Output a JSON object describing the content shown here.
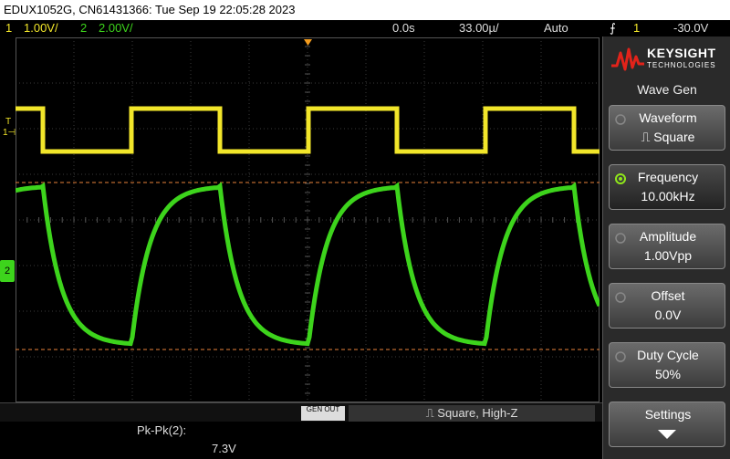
{
  "title_bar": {
    "text": "EDUX1052G, CN61431366: Tue Sep 19 22:05:28 2023"
  },
  "status": {
    "ch1_num": "1",
    "ch1_scale": "1.00V/",
    "ch2_num": "2",
    "ch2_scale": "2.00V/",
    "time_delay": "0.0s",
    "time_scale": "33.00µ/",
    "trigger_mode": "Auto",
    "trigger_icon": "rising-edge-icon",
    "trigger_source": "1",
    "trigger_level": "-30.0V"
  },
  "markers": {
    "ch1": "T\n1",
    "ch2": "2"
  },
  "softkeys": {
    "gen_out": "GEN OUT",
    "description": "⎍ Square, High-Z"
  },
  "measurement": {
    "label": "Pk-Pk(2):",
    "value": "7.3V"
  },
  "panel": {
    "brand": "KEYSIGHT",
    "brand_sub": "TECHNOLOGIES",
    "menu_title": "Wave Gen",
    "keys": [
      {
        "label": "Waveform",
        "value": "⎍ Square",
        "knob": "inactive"
      },
      {
        "label": "Frequency",
        "value": "10.00kHz",
        "knob": "active"
      },
      {
        "label": "Amplitude",
        "value": "1.00Vpp",
        "knob": "inactive"
      },
      {
        "label": "Offset",
        "value": "0.0V",
        "knob": "inactive"
      },
      {
        "label": "Duty Cycle",
        "value": "50%",
        "knob": "inactive"
      },
      {
        "label": "Settings",
        "value": "",
        "knob": "none"
      }
    ]
  },
  "colors": {
    "ch1": "#f2e62a",
    "ch2": "#3dd41c",
    "cursor": "#e8823a",
    "trigger": "#f39c1e"
  },
  "scope": {
    "cursors": [
      {
        "label": "upper"
      },
      {
        "label": "lower"
      }
    ]
  }
}
